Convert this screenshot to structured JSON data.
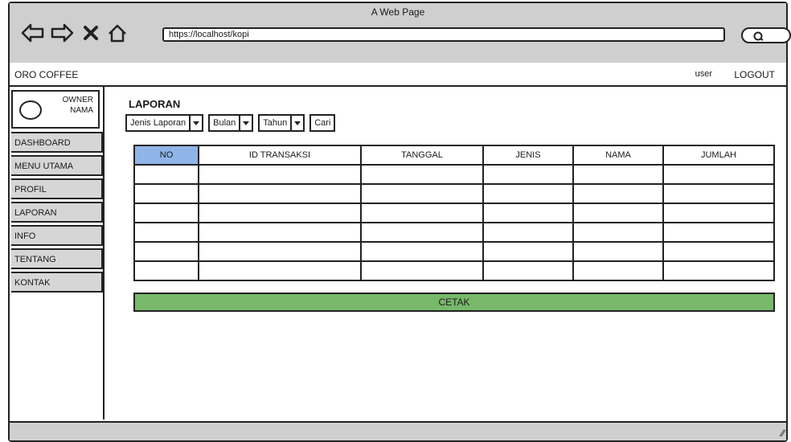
{
  "window": {
    "title": "A Web Page"
  },
  "browser": {
    "url": "https://localhost/kopi",
    "icons": [
      "back-arrow-icon",
      "forward-arrow-icon",
      "close-icon",
      "home-icon",
      "search-icon"
    ]
  },
  "app": {
    "brand": "ORO COFFEE",
    "user": "user",
    "logout": "LOGOUT"
  },
  "sidebar": {
    "owner_role": "OWNER",
    "owner_name": "NAMA",
    "items": [
      {
        "label": "DASHBOARD"
      },
      {
        "label": "MENU UTAMA"
      },
      {
        "label": "PROFIL"
      },
      {
        "label": "LAPORAN"
      },
      {
        "label": "INFO"
      },
      {
        "label": "TENTANG"
      },
      {
        "label": "KONTAK"
      }
    ]
  },
  "main": {
    "title": "LAPORAN",
    "filters": {
      "report_type": "Jenis Laporan",
      "month": "Bulan",
      "year": "Tahun",
      "search_button": "Cari"
    },
    "table": {
      "columns": [
        "NO",
        "ID TRANSAKSI",
        "TANGGAL",
        "JENIS",
        "NAMA",
        "JUMLAH"
      ],
      "row_count": 6
    },
    "print_button": "CETAK"
  },
  "colors": {
    "chrome": "#cfcfcf",
    "menu_item": "#d6d6d6",
    "header_highlight": "#8fb4e8",
    "print_button": "#77b86a"
  }
}
